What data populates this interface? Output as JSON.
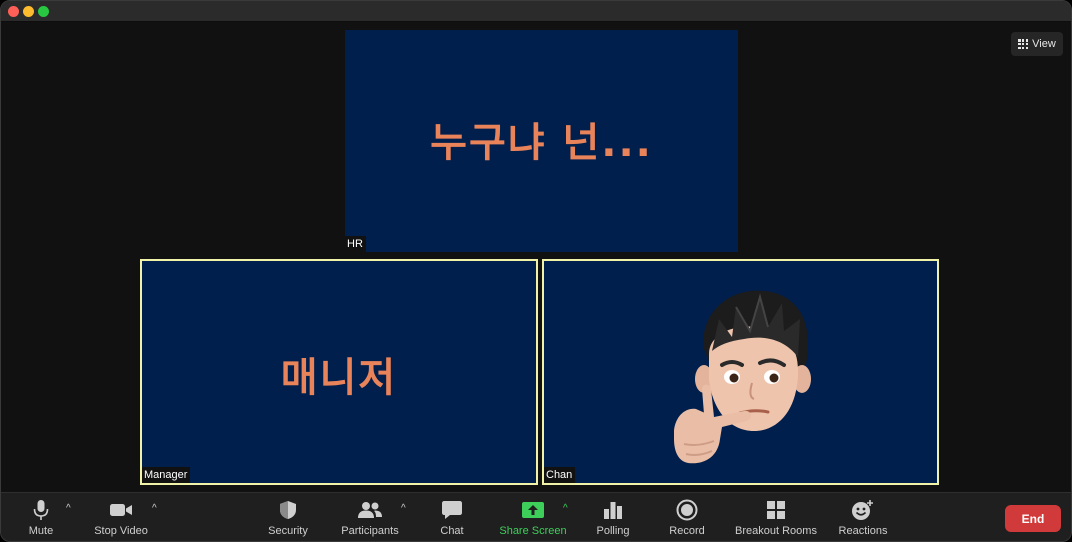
{
  "window": {
    "traffic_lights": [
      "close",
      "minimize",
      "maximize"
    ]
  },
  "view_button": {
    "label": "View",
    "icon": "grid-view-icon"
  },
  "tiles": {
    "hr": {
      "name": "HR",
      "slide_text": "누구냐 넌..."
    },
    "manager": {
      "name": "Manager",
      "slide_text": "매니저"
    },
    "chan": {
      "name": "Chan",
      "avatar": "memoji-thinking"
    }
  },
  "toolbar": {
    "mute": {
      "label": "Mute",
      "icon": "microphone-icon"
    },
    "stop_video": {
      "label": "Stop Video",
      "icon": "video-camera-icon"
    },
    "security": {
      "label": "Security",
      "icon": "shield-icon"
    },
    "participants": {
      "label": "Participants",
      "icon": "participants-icon"
    },
    "chat": {
      "label": "Chat",
      "icon": "chat-bubble-icon"
    },
    "share_screen": {
      "label": "Share Screen",
      "icon": "share-arrow-icon"
    },
    "polling": {
      "label": "Polling",
      "icon": "bar-chart-icon"
    },
    "record": {
      "label": "Record",
      "icon": "record-icon"
    },
    "breakout_rooms": {
      "label": "Breakout Rooms",
      "icon": "breakout-grid-icon"
    },
    "reactions": {
      "label": "Reactions",
      "icon": "smiley-plus-icon"
    },
    "end": {
      "label": "End"
    }
  },
  "colors": {
    "tile_bg": "#001f4d",
    "slide_text": "#e8835a",
    "active_border": "#f0f2a8",
    "share_green": "#3ecf5a",
    "end_red": "#d13a3a"
  }
}
